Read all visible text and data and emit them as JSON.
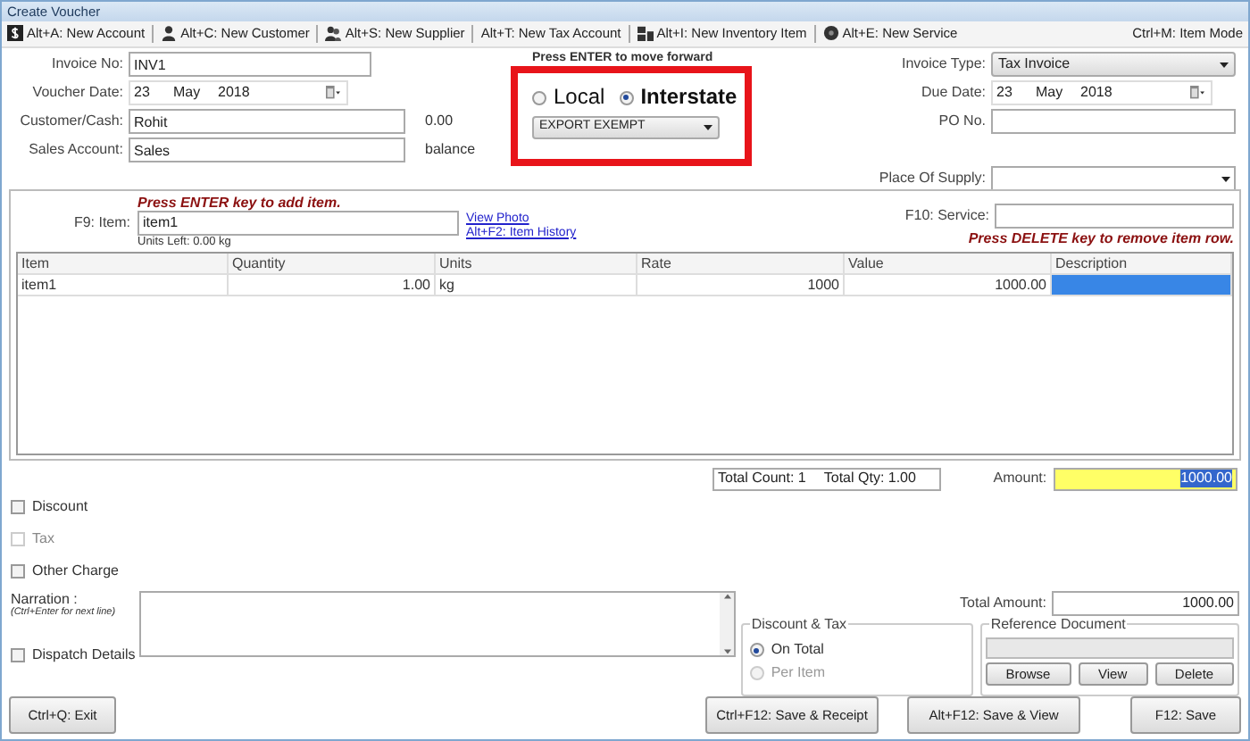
{
  "window": {
    "title": "Create Voucher"
  },
  "toolbar": {
    "items": [
      {
        "kind": "dollar",
        "label": "Alt+A: New Account"
      },
      {
        "kind": "user",
        "label": "Alt+C: New Customer"
      },
      {
        "kind": "users",
        "label": "Alt+S: New Supplier"
      },
      {
        "kind": "none",
        "label": "Alt+T: New Tax Account"
      },
      {
        "kind": "inventory",
        "label": "Alt+I: New Inventory Item"
      },
      {
        "kind": "service",
        "label": "Alt+E: New Service"
      }
    ],
    "right_label": "Ctrl+M: Item Mode"
  },
  "header": {
    "invoice_no": {
      "label": "Invoice No:",
      "value": "INV1"
    },
    "voucher_date": {
      "label": "Voucher Date:",
      "day": "23",
      "month": "May",
      "year": "2018"
    },
    "customer": {
      "label": "Customer/Cash:",
      "value": "Rohit",
      "note": "0.00"
    },
    "sales_account": {
      "label": "Sales Account:",
      "value": "Sales",
      "note": "balance"
    },
    "hint": "Press ENTER to move forward",
    "supply": [
      {
        "label": "Local",
        "selected": false
      },
      {
        "label": "Interstate",
        "selected": true
      }
    ],
    "tax_category": "EXPORT EXEMPT",
    "invoice_type": {
      "label": "Invoice Type:",
      "value": "Tax Invoice"
    },
    "due_date": {
      "label": "Due Date:",
      "day": "23",
      "month": "May",
      "year": "2018"
    },
    "po_no": {
      "label": "PO No."
    },
    "place_of_supply": {
      "label": "Place Of Supply:"
    }
  },
  "item_entry": {
    "hint": "Press ENTER key to add item.",
    "item_label": "F9: Item:",
    "item_value": "item1",
    "units_left": "Units Left: 0.00 kg",
    "links": [
      "View Photo",
      "Alt+F2: Item History"
    ],
    "service_label": "F10: Service:",
    "delete_hint": "Press DELETE key to remove item row."
  },
  "table": {
    "columns": [
      "Item",
      "Quantity",
      "Units",
      "Rate",
      "Value",
      "Description"
    ],
    "rows": [
      {
        "item": "item1",
        "quantity": "1.00",
        "units": "kg",
        "rate": "1000",
        "value": "1000.00",
        "description_selected": true
      }
    ]
  },
  "totals": {
    "count": "Total Count: 1",
    "qty": "Total Qty: 1.00",
    "amount_label": "Amount:",
    "amount": "1000.00",
    "amount_text_selected": true
  },
  "options": [
    {
      "label": "Discount",
      "checked": false,
      "disabled": false
    },
    {
      "label": "Tax",
      "checked": false,
      "disabled": true
    },
    {
      "label": "Other Charge",
      "checked": false,
      "disabled": false
    }
  ],
  "narration": {
    "label": "Narration :",
    "hint": "(Ctrl+Enter for next line)"
  },
  "dispatch": {
    "label": "Dispatch Details",
    "checked": false
  },
  "total_amount": {
    "label": "Total Amount:",
    "value": "1000.00"
  },
  "discount_tax": {
    "title": "Discount & Tax",
    "options": [
      {
        "label": "On Total",
        "selected": true,
        "disabled": false
      },
      {
        "label": "Per Item",
        "selected": false,
        "disabled": true
      }
    ]
  },
  "reference": {
    "title": "Reference Document",
    "buttons": [
      "Browse",
      "View",
      "Delete"
    ]
  },
  "footer": {
    "exit": "Ctrl+Q: Exit",
    "buttons": [
      "Ctrl+F12: Save & Receipt",
      "Alt+F12: Save & View",
      "F12: Save"
    ]
  }
}
